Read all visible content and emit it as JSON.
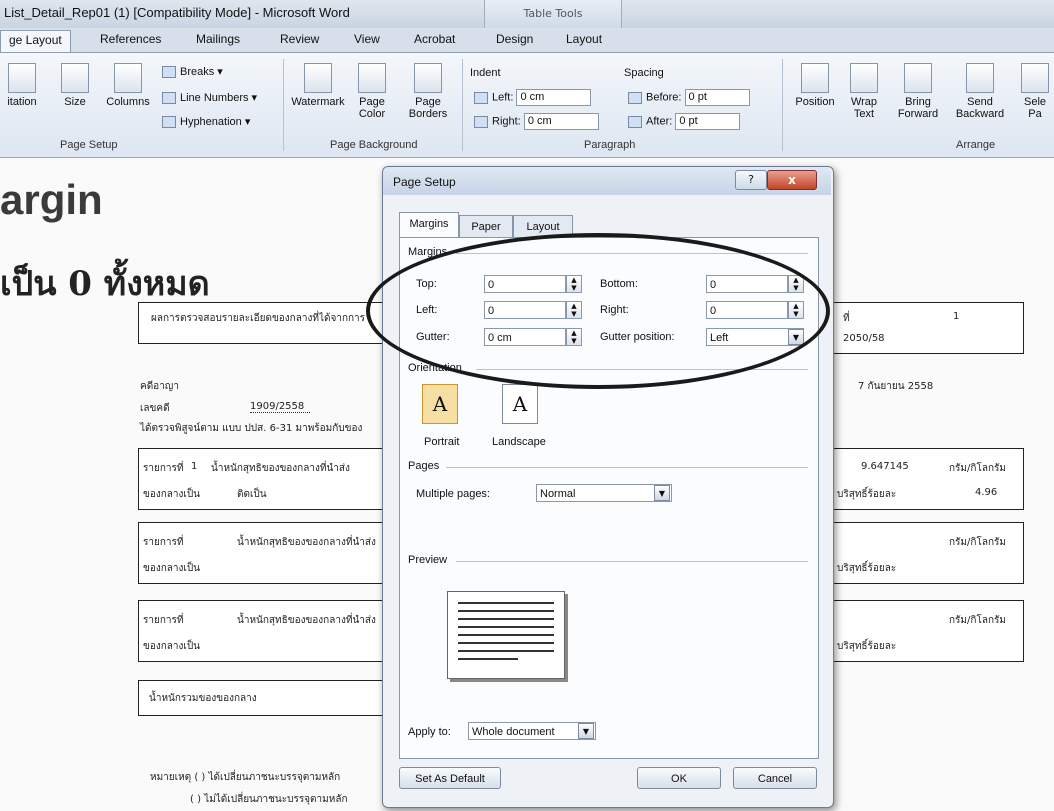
{
  "window": {
    "title": "List_Detail_Rep01 (1) [Compatibility Mode] - Microsoft Word",
    "context_tools": "Table Tools"
  },
  "ribbon_tabs": [
    "ge Layout",
    "References",
    "Mailings",
    "Review",
    "View",
    "Acrobat",
    "Design",
    "Layout"
  ],
  "ribbon": {
    "page_setup": {
      "orientation": "itation",
      "size": "Size",
      "columns": "Columns",
      "breaks": "Breaks",
      "line_numbers": "Line Numbers",
      "hyphenation": "Hyphenation",
      "label": "Page Setup"
    },
    "page_background": {
      "watermark": "Watermark",
      "page_color": "Page Color",
      "page_borders": "Page Borders",
      "label": "Page Background"
    },
    "paragraph": {
      "indent_label": "Indent",
      "left_label": "Left:",
      "left_value": "0 cm",
      "right_label": "Right:",
      "right_value": "0 cm",
      "spacing_label": "Spacing",
      "before_label": "Before:",
      "before_value": "0 pt",
      "after_label": "After:",
      "after_value": "0 pt",
      "label": "Paragraph"
    },
    "arrange": {
      "position": "Position",
      "wrap_text": "Wrap Text",
      "bring_forward": "Bring Forward",
      "send_backward": "Send Backward",
      "selection": "Sele Pa",
      "label": "Arrange"
    }
  },
  "document": {
    "heading_en": "argin",
    "heading_th": "เป็น 0 ทั้งหมด",
    "form_row_1_left": "ผลการตรวจสอบรายละเอียดของกลางที่ได้จากการ",
    "form_row_1_right_label": "ที่",
    "form_row_1_right_value": "1",
    "form_row_1_right_sub": "2050/58",
    "line_a_left": "คดีอาญา",
    "line_a_right": "7 กันยายน 2558",
    "line_b_left": "เลขคดี",
    "line_b_mid": "1909/2558",
    "line_c": "ได้ตรวจพิสูจน์ตาม แบบ ปปส. 6-31 มาพร้อมกับของ",
    "item1_label": "รายการที่",
    "item1_num": "1",
    "item1_text": "น้ำหนักสุทธิของของกลางที่นำส่ง",
    "item1_weight": "9.647145",
    "item1_unit": "กรัม/กิโลกรัม",
    "item1_type_label": "ของกลางเป็น",
    "item1_type": "ติดเป็น",
    "item1_purity_label": "บริสุทธิ์ร้อยละ",
    "item1_purity": "4.96",
    "item2_label": "รายการที่",
    "item2_text": "น้ำหนักสุทธิของของกลางที่นำส่ง",
    "item2_unit": "กรัม/กิโลกรัม",
    "item2_type_label": "ของกลางเป็น",
    "item2_purity_label": "บริสุทธิ์ร้อยละ",
    "item3_label": "รายการที่",
    "item3_text": "น้ำหนักสุทธิของของกลางที่นำส่ง",
    "item3_unit": "กรัม/กิโลกรัม",
    "item3_type_label": "ของกลางเป็น",
    "item3_purity_label": "บริสุทธิ์ร้อยละ",
    "footer_box": "น้ำหนักรวมของของกลาง",
    "note_1": "หมายเหตุ ( ) ได้เปลี่ยนภาชนะบรรจุตามหลัก",
    "note_2": "( ) ไม่ได้เปลี่ยนภาชนะบรรจุตามหลัก"
  },
  "dialog": {
    "title": "Page Setup",
    "help": "?",
    "close": "x",
    "tabs": [
      "Margins",
      "Paper",
      "Layout"
    ],
    "margins_group": "Margins",
    "top_label": "Top:",
    "top_value": "0",
    "bottom_label": "Bottom:",
    "bottom_value": "0",
    "left_label": "Left:",
    "left_value": "0",
    "right_label": "Right:",
    "right_value": "0",
    "gutter_label": "Gutter:",
    "gutter_value": "0 cm",
    "gutter_pos_label": "Gutter position:",
    "gutter_pos_value": "Left",
    "orientation_group": "Orientation",
    "portrait": "Portrait",
    "landscape": "Landscape",
    "pages_group": "Pages",
    "multiple_pages_label": "Multiple pages:",
    "multiple_pages_value": "Normal",
    "preview_group": "Preview",
    "apply_to_label": "Apply to:",
    "apply_to_value": "Whole document",
    "set_default": "Set As Default",
    "ok": "OK",
    "cancel": "Cancel"
  }
}
